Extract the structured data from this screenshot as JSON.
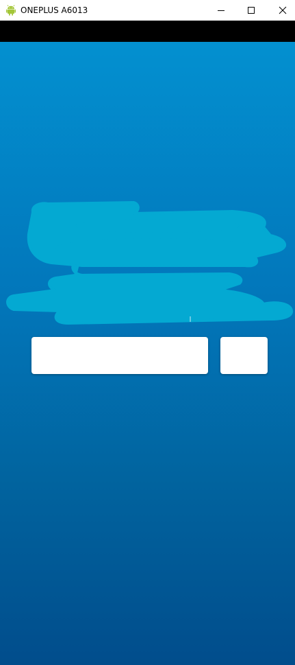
{
  "window": {
    "title": "ONEPLUS A6013",
    "app_icon": "android-icon",
    "controls": {
      "minimize_icon": "minimize-icon",
      "maximize_icon": "maximize-icon",
      "close_icon": "close-icon"
    }
  },
  "colors": {
    "titlebar_bg": "#ffffff",
    "statusbar_bg": "#000000",
    "screen_gradient_top": "#0390d0",
    "screen_gradient_bottom": "#014d8c",
    "scribble": "#04a9d2",
    "android_green": "#a4c639"
  },
  "screen": {
    "input": {
      "value": "",
      "placeholder": ""
    },
    "button": {
      "label": ""
    }
  }
}
